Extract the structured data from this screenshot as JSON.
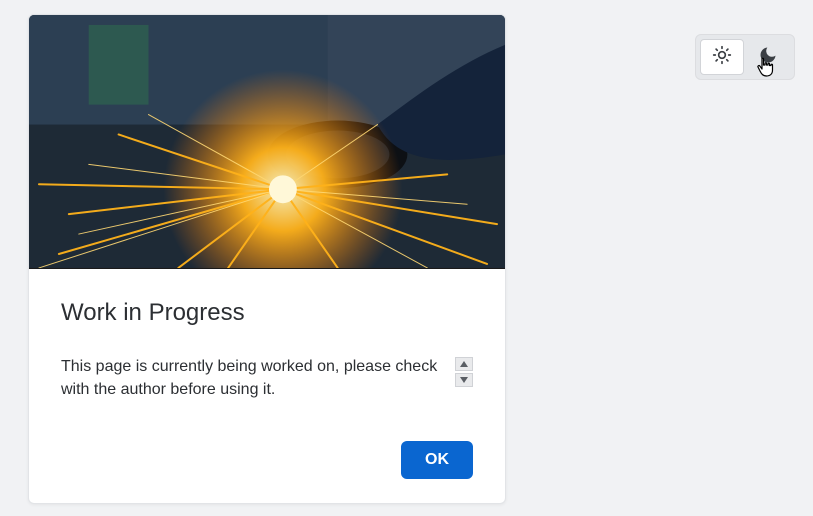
{
  "card": {
    "title": "Work in Progress",
    "body": "This page is currently being worked on, please check with the author before using it.",
    "ok_label": "OK"
  },
  "theme": {
    "light_icon": "sun-icon",
    "dark_icon": "moon-icon",
    "active": "dark"
  }
}
